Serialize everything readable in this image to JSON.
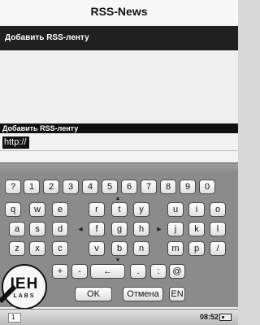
{
  "app": {
    "title": "RSS-News"
  },
  "menu": {
    "add_feed_label": "Добавить RSS-ленту"
  },
  "dialog": {
    "header": "Добавить RSS-ленту",
    "url_value": "http://"
  },
  "keyboard": {
    "rows": [
      [
        "?",
        "1",
        "2",
        "3",
        "4",
        "5",
        "6",
        "7",
        "8",
        "9",
        "0"
      ],
      [
        "q",
        "w",
        "e",
        "r",
        "t",
        "y",
        "u",
        "i",
        "o",
        "p"
      ],
      [
        "a",
        "s",
        "d",
        "f",
        "g",
        "h",
        "j",
        "k",
        "l"
      ],
      [
        "z",
        "x",
        "c",
        "v",
        "b",
        "n",
        "m",
        "p",
        "/"
      ],
      [
        "+",
        "-",
        "←",
        ".",
        ":",
        "@"
      ]
    ],
    "ok_label": "OK",
    "cancel_label": "Отмена",
    "lang_label": "EN"
  },
  "logo": {
    "main": "IEH",
    "sub": "LABS"
  },
  "status": {
    "page": "1",
    "time": "08:52"
  }
}
